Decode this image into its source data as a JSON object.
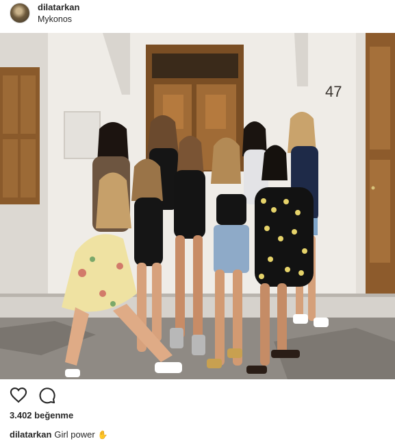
{
  "post": {
    "username": "dilatarkan",
    "location": "Mykonos",
    "house_number": "47",
    "likes_text": "3.402 beğenme",
    "caption_user": "dilatarkan",
    "caption_text": "Girl power",
    "caption_emoji": "✋"
  },
  "icons": {
    "like": "heart-icon",
    "comment": "comment-bubble-icon",
    "avatar": "profile-avatar"
  },
  "colors": {
    "text": "#262626",
    "background": "#ffffff"
  }
}
